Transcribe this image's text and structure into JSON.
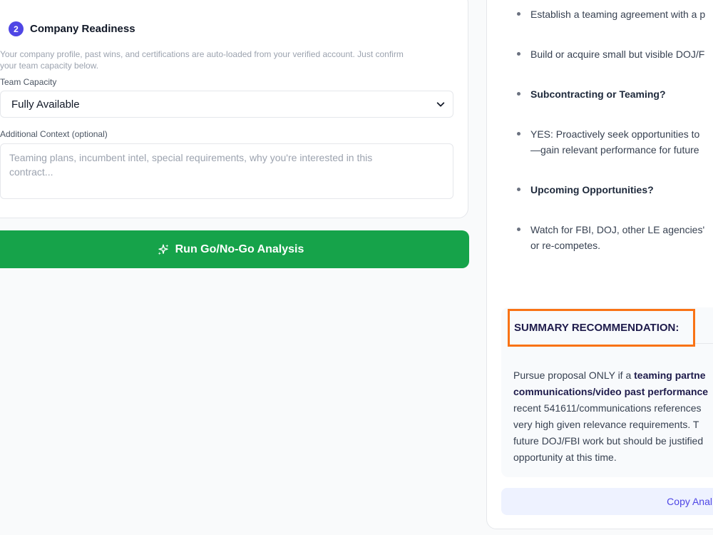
{
  "readiness": {
    "step_number": "2",
    "title": "Company Readiness",
    "description_line1": "Your company profile, past wins, and certifications are auto-loaded from your verified account. Just confirm",
    "description_line2": "your team capacity below.",
    "team_capacity_label": "Team Capacity",
    "team_capacity_value": "Fully Available",
    "context_label": "Additional Context (optional)",
    "context_placeholder_line1": "Teaming plans, incumbent intel, special requirements, why you're interested in this",
    "context_placeholder_line2": "contract..."
  },
  "run_button": {
    "label": "Run Go/No-Go Analysis"
  },
  "analysis": {
    "bullets": [
      {
        "text": "Establish a teaming agreement with a p",
        "bold": false
      },
      {
        "text": "Build or acquire small but visible DOJ/F",
        "bold": false
      },
      {
        "text": "Subcontracting or Teaming?",
        "bold": true
      },
      {
        "text": "YES: Proactively seek opportunities to",
        "bold": false
      },
      {
        "text": "—gain relevant performance for future",
        "bold": false
      },
      {
        "text": "Upcoming Opportunities?",
        "bold": true
      },
      {
        "text": "Watch for FBI, DOJ, other LE agencies'",
        "bold": false
      },
      {
        "text": "or re-competes.",
        "bold": false
      }
    ],
    "summary_title": "SUMMARY RECOMMENDATION:",
    "summary": {
      "l1_plain": "Pursue proposal ONLY if a ",
      "l1_bold": "teaming partne",
      "l2_bold": "communications/video past performance",
      "l3": "recent 541611/communications references",
      "l4": "very high given relevance requirements. T",
      "l5": "future DOJ/FBI work but should be justified",
      "l6": "opportunity at this time."
    },
    "copy_button": "Copy Anal"
  },
  "colors": {
    "accent": "#4f46e5",
    "run_button": "#16a34a",
    "highlight_box": "#f97316"
  },
  "icons": {
    "run_button_icon": "sparkles-icon",
    "select_icon": "chevron-down-icon"
  }
}
